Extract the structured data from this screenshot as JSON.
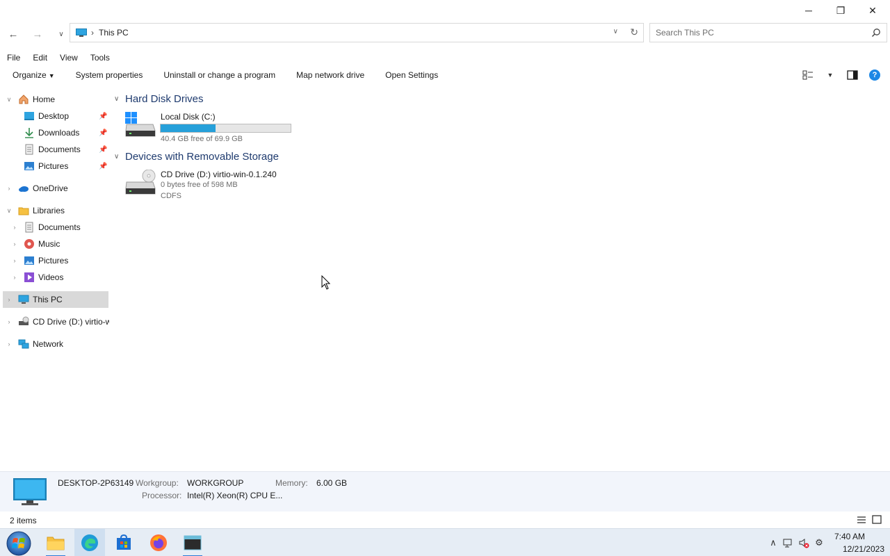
{
  "window": {
    "minimize_glyph": "─",
    "maximize_glyph": "❐",
    "close_glyph": "✕"
  },
  "address": {
    "path": "This PC",
    "search_placeholder": "Search This PC"
  },
  "menubar": {
    "file": "File",
    "edit": "Edit",
    "view": "View",
    "tools": "Tools"
  },
  "commandbar": {
    "organize": "Organize",
    "system_properties": "System properties",
    "uninstall": "Uninstall or change a program",
    "map_drive": "Map network drive",
    "open_settings": "Open Settings"
  },
  "sidebar": {
    "home": "Home",
    "desktop": "Desktop",
    "downloads": "Downloads",
    "documents": "Documents",
    "pictures": "Pictures",
    "onedrive": "OneDrive",
    "libraries": "Libraries",
    "lib_documents": "Documents",
    "lib_music": "Music",
    "lib_pictures": "Pictures",
    "lib_videos": "Videos",
    "this_pc": "This PC",
    "cd_drive": "CD Drive (D:) virtio-w",
    "network": "Network"
  },
  "content": {
    "group_hdd": "Hard Disk Drives",
    "group_removable": "Devices with Removable Storage",
    "drive_c": {
      "name": "Local Disk (C:)",
      "free_text": "40.4 GB free of 69.9 GB",
      "used_fraction": 0.42
    },
    "drive_d": {
      "name": "CD Drive (D:) virtio-win-0.1.240",
      "free_text": "0 bytes free of 598 MB",
      "fs": "CDFS"
    }
  },
  "details": {
    "computer_name": "DESKTOP-2P63149",
    "workgroup_label": "Workgroup:",
    "workgroup": "WORKGROUP",
    "memory_label": "Memory:",
    "memory": "6.00 GB",
    "processor_label": "Processor:",
    "processor": "Intel(R) Xeon(R) CPU E..."
  },
  "status": {
    "items": "2 items"
  },
  "taskbar": {
    "time": "7:40 AM",
    "date": "12/21/2023"
  },
  "colors": {
    "accent": "#26a0da",
    "group_header": "#1e3a6e",
    "details_bg": "#f2f5fb",
    "taskbar_bg": "#e6edf5"
  }
}
